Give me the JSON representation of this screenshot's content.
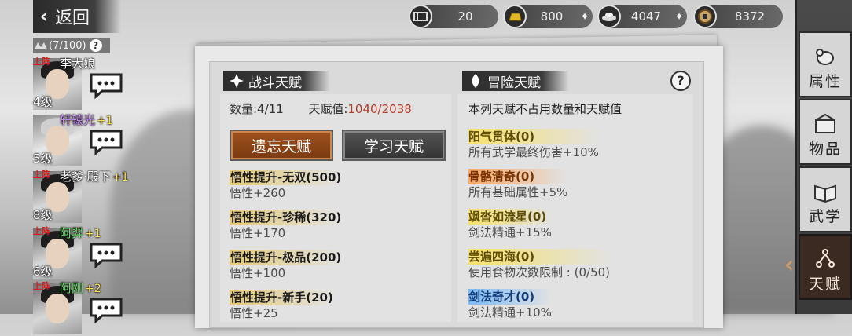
{
  "topbar": {
    "back_label": "返回",
    "resources": [
      {
        "icon": "ticket-icon",
        "value": "20",
        "has_plus": false
      },
      {
        "icon": "gold-bar-icon",
        "value": "800",
        "has_plus": true
      },
      {
        "icon": "silver-ingot-icon",
        "value": "4047",
        "has_plus": true
      },
      {
        "icon": "copper-coin-icon",
        "value": "8372",
        "has_plus": false
      }
    ]
  },
  "party": {
    "count": "(7/100)",
    "members": [
      {
        "tag": "上阵",
        "name": "李大娘",
        "bonus": "",
        "level": "4级",
        "color": "white"
      },
      {
        "tag": "",
        "name": "轩辕光",
        "bonus": "+1",
        "level": "5级",
        "color": "purple"
      },
      {
        "tag": "上阵",
        "name": "老爹·殿下",
        "bonus": "+1",
        "level": "8级",
        "color": "white"
      },
      {
        "tag": "上阵",
        "name": "阿羿",
        "bonus": "+1",
        "level": "6级",
        "color": "green"
      },
      {
        "tag": "上阵",
        "name": "阿刚",
        "bonus": "+2",
        "level": "",
        "color": "green"
      }
    ]
  },
  "combat": {
    "title": "战斗天赋",
    "count_label": "数量:4/11",
    "value_label": "天赋值:",
    "value": "1040/2038",
    "forget_button": "遗忘天赋",
    "learn_button": "学习天赋",
    "talents": [
      {
        "name": "悟性提升-无双(500)",
        "desc": "悟性+260"
      },
      {
        "name": "悟性提升-珍稀(320)",
        "desc": "悟性+170"
      },
      {
        "name": "悟性提升-极品(200)",
        "desc": "悟性+100"
      },
      {
        "name": "悟性提升-新手(20)",
        "desc": "悟性+25"
      }
    ]
  },
  "adventure": {
    "title": "冒险天赋",
    "note": "本列天赋不占用数量和天赋值",
    "talents": [
      {
        "name": "阳气贯体(0)",
        "desc": "所有武学最终伤害+10%",
        "color": "yellow"
      },
      {
        "name": "骨骼清奇(0)",
        "desc": "所有基础属性+5%",
        "color": "orange"
      },
      {
        "name": "飒沓如流星(0)",
        "desc": "剑法精通+15%",
        "color": "yellow"
      },
      {
        "name": "尝遍四海(0)",
        "desc": "使用食物次数限制 : (0/50)",
        "color": "yellow"
      },
      {
        "name": "剑法奇才(0)",
        "desc": "剑法精通+10%",
        "color": "blue"
      }
    ]
  },
  "side_tabs": [
    {
      "label": "属性",
      "icon": "mouse-icon",
      "active": false
    },
    {
      "label": "物品",
      "icon": "chest-icon",
      "active": false
    },
    {
      "label": "武学",
      "icon": "book-icon",
      "active": false
    },
    {
      "label": "天赋",
      "icon": "talent-tree-icon",
      "active": true
    }
  ]
}
